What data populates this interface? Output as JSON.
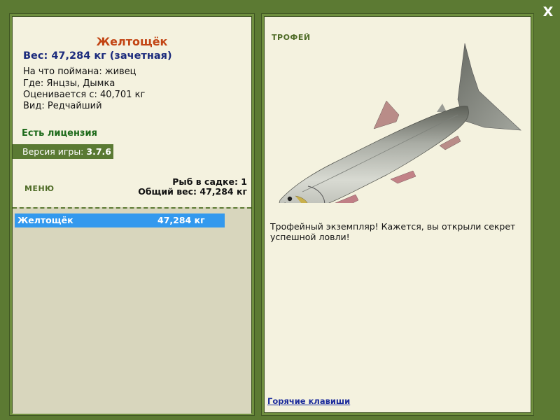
{
  "close_label": "X",
  "fish": {
    "name": "Желтощёк",
    "weight_line": "Вес: 47,284 кг (зачетная)",
    "info": [
      "На что поймана: живец",
      "Где: Янцзы, Дымка",
      "Оценивается с: 40,701 кг",
      "Вид: Редчайший"
    ]
  },
  "license": "Есть лицензия",
  "version": {
    "label": "Версия игры:",
    "value": "3.7.6"
  },
  "menu_label": "МЕНЮ",
  "cage": {
    "count_line": "Рыб в садке: 1",
    "total_line": "Общий вес: 47,284 кг"
  },
  "catch_list": [
    {
      "name": "Желтощёк",
      "weight": "47,284 кг"
    }
  ],
  "trophy_label": "ТРОФЕЙ",
  "description": "Трофейный экземпляр! Кажется, вы открыли секрет успешной ловли!",
  "hotkeys_link": "Горячие клавиши",
  "colors": {
    "background": "#5c7a33",
    "panel": "#f4f2df",
    "fish_name": "#c24514",
    "weight": "#1b2b7c",
    "license": "#1d6a1a",
    "selected_row": "#3399ee",
    "link": "#1b2b9c"
  }
}
